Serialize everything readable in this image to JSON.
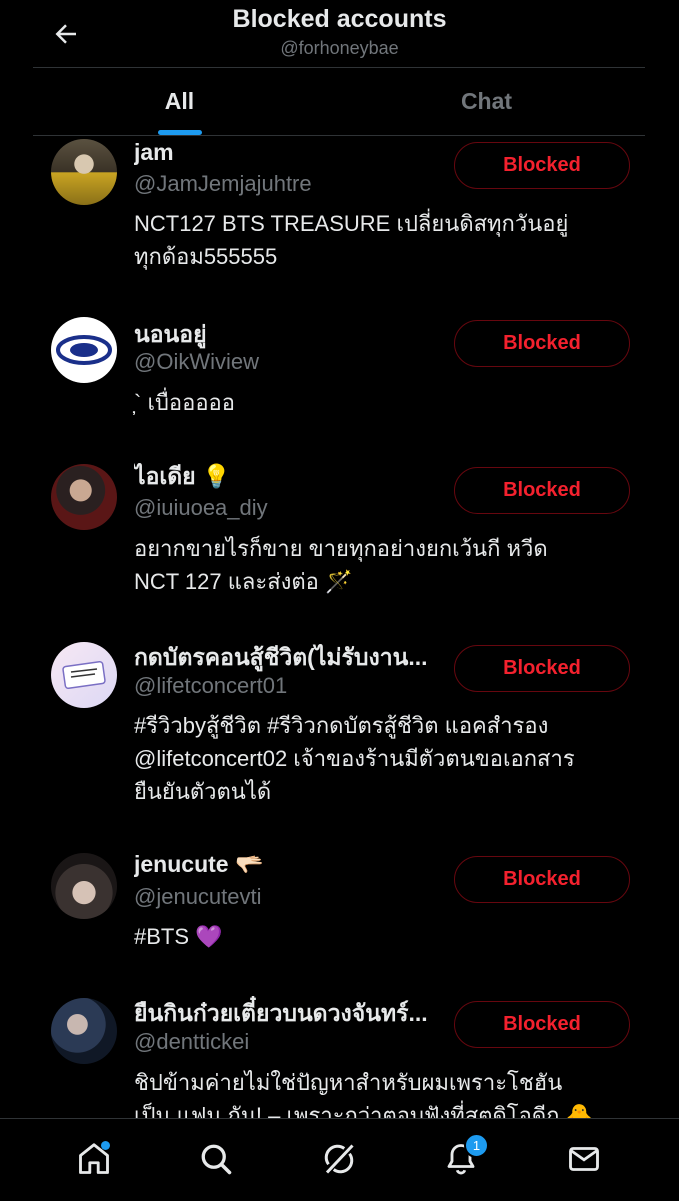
{
  "header": {
    "title": "Blocked accounts",
    "username": "@forhoneybae"
  },
  "tabs": [
    {
      "label": "All",
      "active": true
    },
    {
      "label": "Chat",
      "active": false
    }
  ],
  "accounts": [
    {
      "name": "jam",
      "handle": "@JamJemjajuhtre",
      "bio_lines": [
        "NCT127 BTS TREASURE เปลี่ยนดิสทุกวันอยู่",
        "ทุกด้อม555555"
      ],
      "button": "Blocked"
    },
    {
      "name": "นอนอยู่",
      "handle": "@OikWiview",
      "bio_lines": [
        "̦` เบื่อออออ"
      ],
      "button": "Blocked"
    },
    {
      "name": "ไอเดีย 💡",
      "handle": "@iuiuoea_diy",
      "bio_lines": [
        "อยากขายไรก็ขาย ขายทุกอย่างยกเว้นกี หวีด",
        "NCT 127 และส่งต่อ 🪄"
      ],
      "button": "Blocked"
    },
    {
      "name": "กดบัตรคอนสู้ชีวิต(ไม่รับงาน...",
      "handle": "@lifetconcert01",
      "bio_lines": [
        "#รีวิวbyสู้ชีวิต #รีวิวกดบัตรสู้ชีวิต แอคสำรอง",
        "@lifetconcert02 เจ้าของร้านมีตัวตนขอเอกสาร",
        "ยืนยันตัวตนได้"
      ],
      "button": "Blocked"
    },
    {
      "name": "jenucute 🫳🏻",
      "handle": "@jenucutevti",
      "bio_lines": [
        "#BTS 💜"
      ],
      "button": "Blocked"
    },
    {
      "name": "ยืนกินก๋วยเตี๋ยวบนดวงจันทร์...",
      "handle": "@denttickei",
      "bio_lines": [
        "ชิปข้ามค่ายไม่ใช่ปัญหาสำหรับผมเพราะโชฮัน",
        "เป็น แฟน กัน! – เพราะกว่าตอบฟังที่สตูดิโอดีก 🐥"
      ],
      "button": "Blocked"
    }
  ],
  "bottom_nav": {
    "items": [
      "home-icon",
      "search-icon",
      "grok-icon",
      "bell-icon",
      "mail-icon"
    ],
    "notification_count": "1"
  },
  "colors": {
    "accent": "#1d9bf0",
    "blocked_text": "#f4212e",
    "blocked_border": "#67070f",
    "secondary_text": "#71767b"
  }
}
